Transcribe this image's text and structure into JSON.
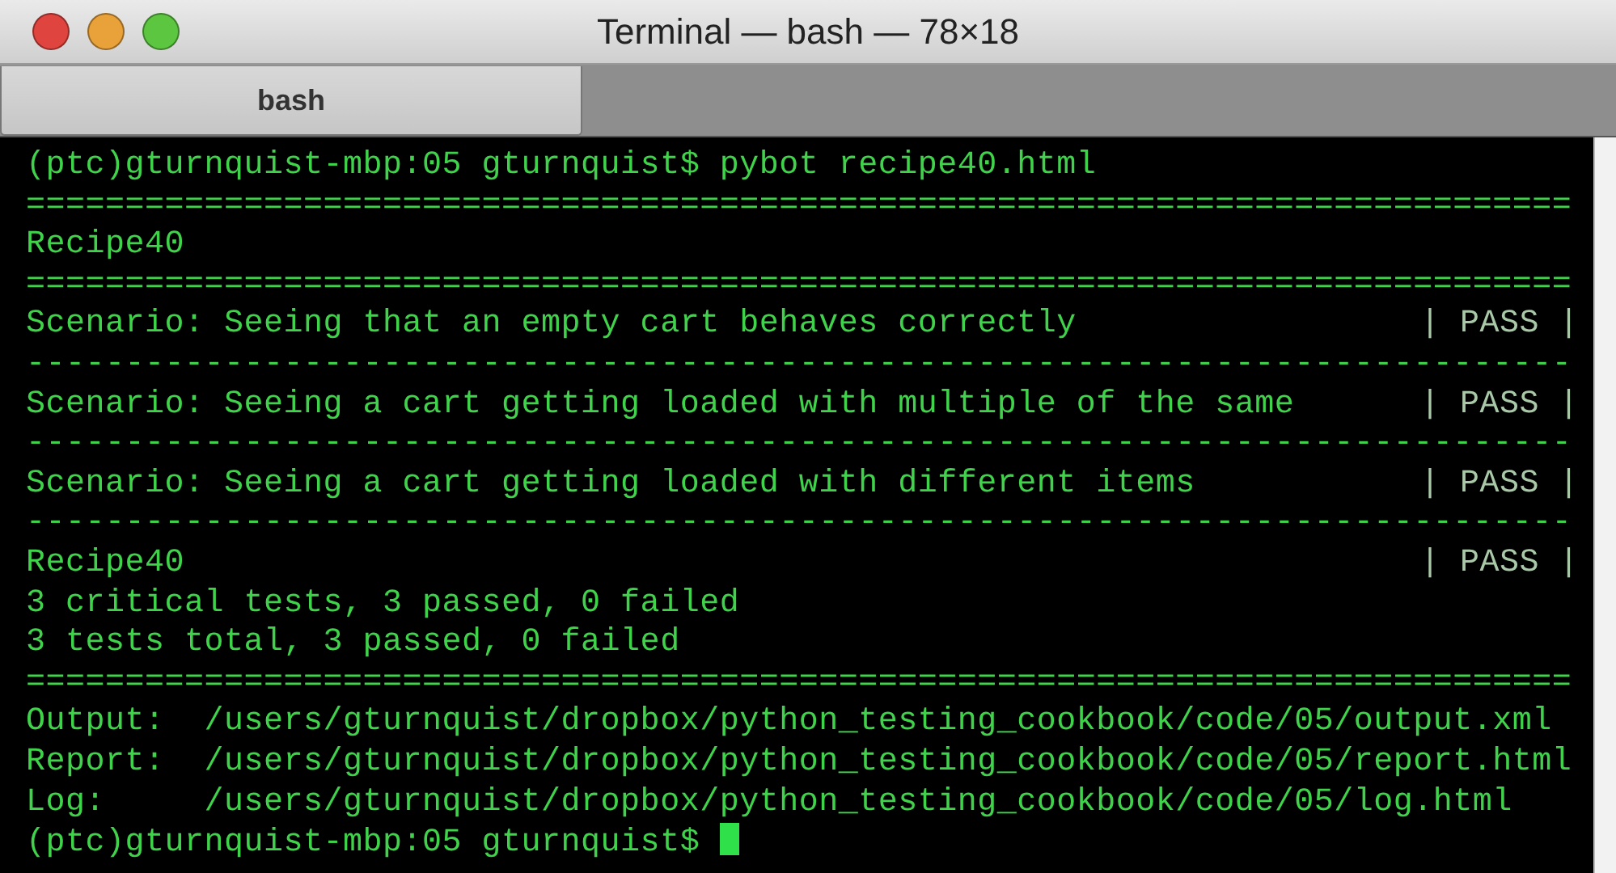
{
  "window": {
    "title": "Terminal — bash — 78×18"
  },
  "tabs": [
    {
      "label": "bash",
      "selected": true
    }
  ],
  "terminal": {
    "lines": [
      {
        "kind": "text",
        "text": "(ptc)gturnquist-mbp:05 gturnquist$ pybot recipe40.html"
      },
      {
        "kind": "rule",
        "text": "=============================================================================="
      },
      {
        "kind": "text",
        "text": "Recipe40"
      },
      {
        "kind": "rule",
        "text": "=============================================================================="
      },
      {
        "kind": "result",
        "text": "Scenario: Seeing that an empty cart behaves correctly",
        "status": "| PASS |"
      },
      {
        "kind": "rule",
        "text": "------------------------------------------------------------------------------"
      },
      {
        "kind": "result",
        "text": "Scenario: Seeing a cart getting loaded with multiple of the same",
        "status": "| PASS |"
      },
      {
        "kind": "rule",
        "text": "------------------------------------------------------------------------------"
      },
      {
        "kind": "result",
        "text": "Scenario: Seeing a cart getting loaded with different items",
        "status": "| PASS |"
      },
      {
        "kind": "rule",
        "text": "------------------------------------------------------------------------------"
      },
      {
        "kind": "result",
        "text": "Recipe40",
        "status": "| PASS |"
      },
      {
        "kind": "text",
        "text": "3 critical tests, 3 passed, 0 failed"
      },
      {
        "kind": "text",
        "text": "3 tests total, 3 passed, 0 failed"
      },
      {
        "kind": "rule",
        "text": "=============================================================================="
      },
      {
        "kind": "text",
        "text": "Output:  /users/gturnquist/dropbox/python_testing_cookbook/code/05/output.xml"
      },
      {
        "kind": "text",
        "text": "Report:  /users/gturnquist/dropbox/python_testing_cookbook/code/05/report.html"
      },
      {
        "kind": "text",
        "text": "Log:     /users/gturnquist/dropbox/python_testing_cookbook/code/05/log.html"
      },
      {
        "kind": "prompt",
        "text": "(ptc)gturnquist-mbp:05 gturnquist$ ",
        "cursor": true
      }
    ]
  }
}
